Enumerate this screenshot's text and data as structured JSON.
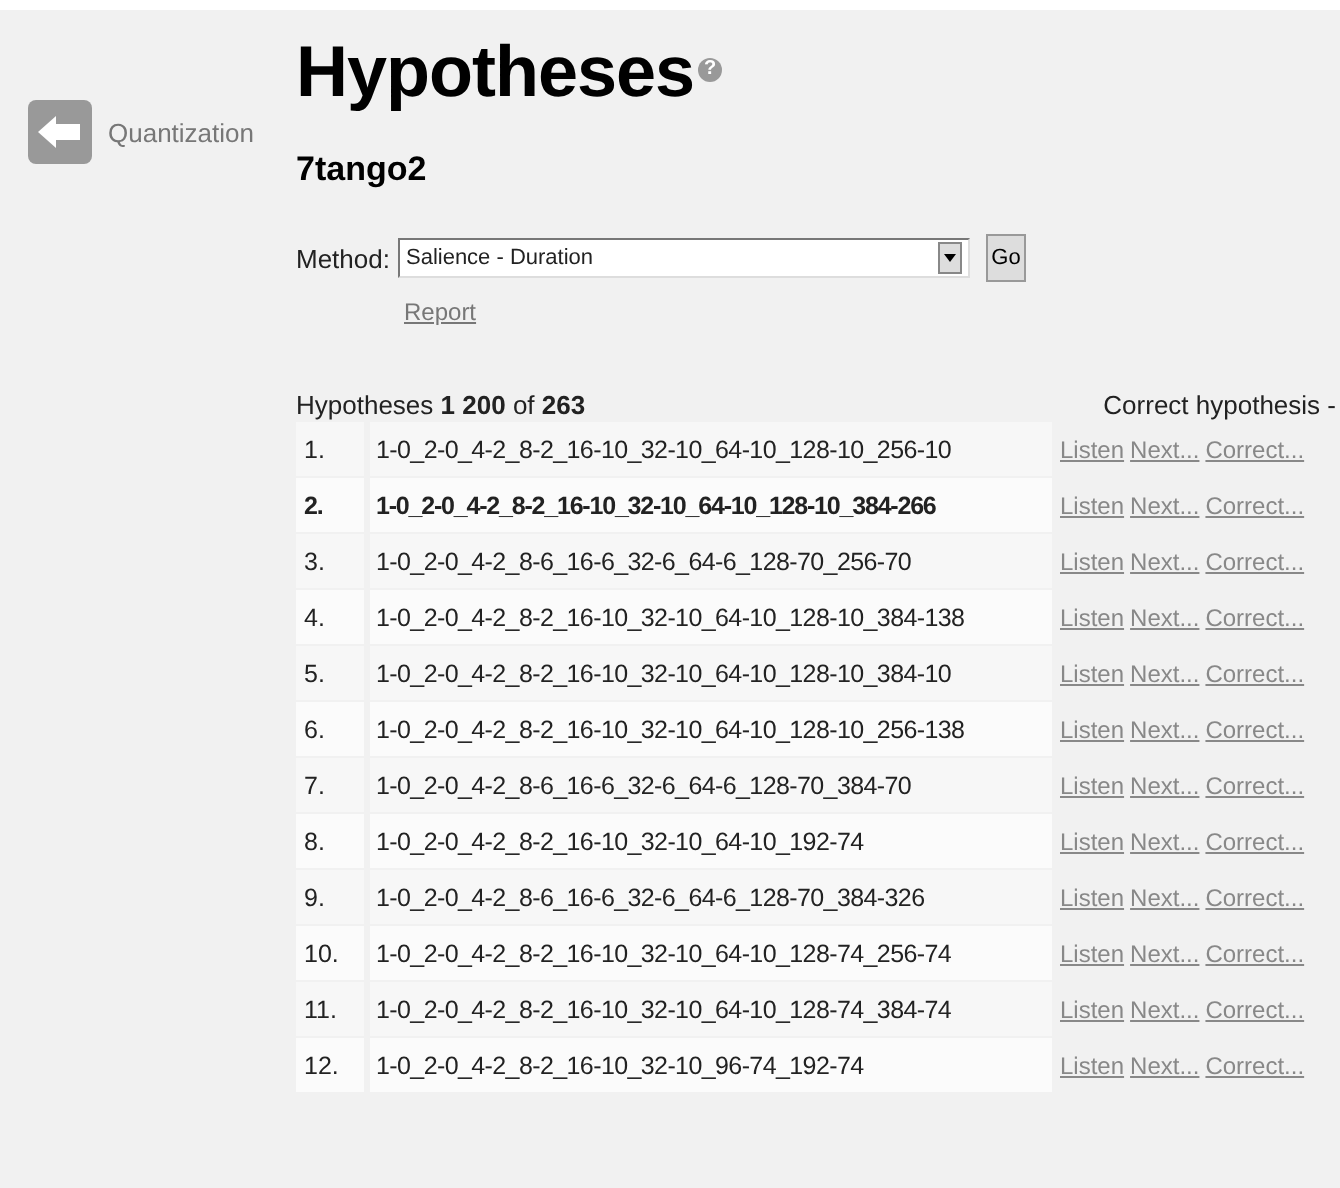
{
  "back_link": {
    "label": "Quantization"
  },
  "title": "Hypotheses",
  "help": "?",
  "subtitle": "7tango2",
  "method": {
    "label": "Method:",
    "value": "Salience - Duration",
    "button": "Go"
  },
  "report_link": "Report",
  "table": {
    "summary": "Hypotheses **1** **200** of **263**",
    "correct_header": "Correct hypothesis -",
    "rows": [
      {
        "num": "1.",
        "hypothesis": "1-0_2-0_4-2_8-2_16-10_32-10_64-10_128-10_256-10",
        "selected": false,
        "links": [
          "Listen",
          "Next...",
          "Correct..."
        ]
      },
      {
        "num": "2.",
        "hypothesis": "1-0_2-0_4-2_8-2_16-10_32-10_64-10_128-10_384-266",
        "selected": true,
        "links": [
          "Listen",
          "Next...",
          "Correct..."
        ]
      },
      {
        "num": "3.",
        "hypothesis": "1-0_2-0_4-2_8-6_16-6_32-6_64-6_128-70_256-70",
        "selected": false,
        "links": [
          "Listen",
          "Next...",
          "Correct..."
        ]
      },
      {
        "num": "4.",
        "hypothesis": "1-0_2-0_4-2_8-2_16-10_32-10_64-10_128-10_384-138",
        "selected": false,
        "links": [
          "Listen",
          "Next...",
          "Correct..."
        ]
      },
      {
        "num": "5.",
        "hypothesis": "1-0_2-0_4-2_8-2_16-10_32-10_64-10_128-10_384-10",
        "selected": false,
        "links": [
          "Listen",
          "Next...",
          "Correct..."
        ]
      },
      {
        "num": "6.",
        "hypothesis": "1-0_2-0_4-2_8-2_16-10_32-10_64-10_128-10_256-138",
        "selected": false,
        "links": [
          "Listen",
          "Next...",
          "Correct..."
        ]
      },
      {
        "num": "7.",
        "hypothesis": "1-0_2-0_4-2_8-6_16-6_32-6_64-6_128-70_384-70",
        "selected": false,
        "links": [
          "Listen",
          "Next...",
          "Correct..."
        ]
      },
      {
        "num": "8.",
        "hypothesis": "1-0_2-0_4-2_8-2_16-10_32-10_64-10_192-74",
        "selected": false,
        "links": [
          "Listen",
          "Next...",
          "Correct..."
        ]
      },
      {
        "num": "9.",
        "hypothesis": "1-0_2-0_4-2_8-6_16-6_32-6_64-6_128-70_384-326",
        "selected": false,
        "links": [
          "Listen",
          "Next...",
          "Correct..."
        ]
      },
      {
        "num": "10.",
        "hypothesis": "1-0_2-0_4-2_8-2_16-10_32-10_64-10_128-74_256-74",
        "selected": false,
        "links": [
          "Listen",
          "Next...",
          "Correct..."
        ]
      },
      {
        "num": "11.",
        "hypothesis": "1-0_2-0_4-2_8-2_16-10_32-10_64-10_128-74_384-74",
        "selected": false,
        "links": [
          "Listen",
          "Next...",
          "Correct..."
        ]
      },
      {
        "num": "12.",
        "hypothesis": "1-0_2-0_4-2_8-2_16-10_32-10_96-74_192-74",
        "selected": false,
        "links": [
          "Listen",
          "Next...",
          "Correct..."
        ]
      }
    ]
  }
}
